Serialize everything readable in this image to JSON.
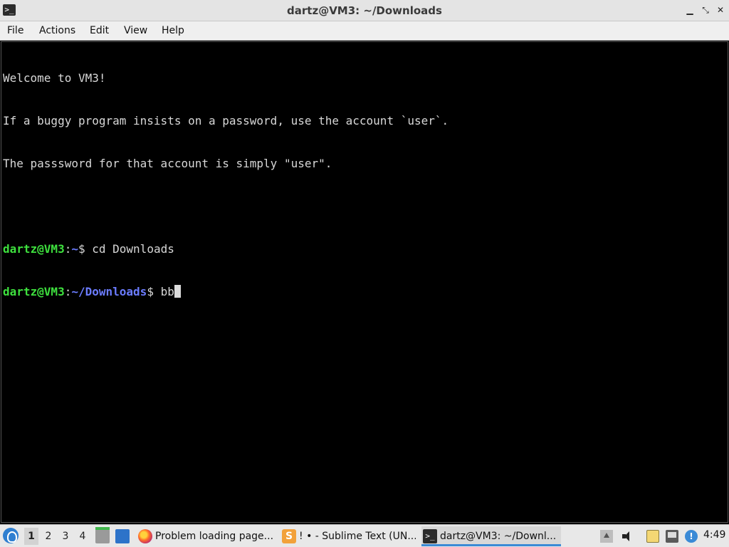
{
  "window": {
    "title": "dartz@VM3: ~/Downloads",
    "icon": "terminal-icon",
    "controls": {
      "minimize": "▁",
      "maximize": "⤡",
      "close": "✕"
    }
  },
  "menubar": {
    "items": [
      "File",
      "Actions",
      "Edit",
      "View",
      "Help"
    ]
  },
  "terminal": {
    "lines": [
      "Welcome to VM3!",
      "If a buggy program insists on a password, use the account `user`.",
      "The passsword for that account is simply \"user\"."
    ],
    "prompt1": {
      "user": "dartz@VM3",
      "colon": ":",
      "path": "~",
      "dollar": "$ ",
      "command": "cd Downloads"
    },
    "prompt2": {
      "user": "dartz@VM3",
      "colon": ":",
      "path": "~/Downloads",
      "dollar": "$ ",
      "command": "bb"
    },
    "colors": {
      "user": "#3ee03e",
      "path": "#6b7cff",
      "text": "#d8d8d8",
      "background": "#000000"
    }
  },
  "taskbar": {
    "start_icon": "lubuntu-start-icon",
    "workspaces": [
      "1",
      "2",
      "3",
      "4"
    ],
    "active_workspace": "1",
    "quicklaunch": [
      "file-manager-icon",
      "show-desktop-icon"
    ],
    "tasks": [
      {
        "label": "Problem loading page...",
        "icon": "firefox-icon",
        "active": false
      },
      {
        "label": "! • - Sublime Text (UN...",
        "icon": "sublime-text-icon",
        "active": false
      },
      {
        "label": "dartz@VM3: ~/Downl...",
        "icon": "terminal-icon",
        "active": true
      }
    ],
    "tray_icons": [
      "tray-up-icon",
      "volume-icon",
      "clipboard-icon",
      "network-icon",
      "info-icon"
    ],
    "info_glyph": "!",
    "clock": "4:49"
  }
}
